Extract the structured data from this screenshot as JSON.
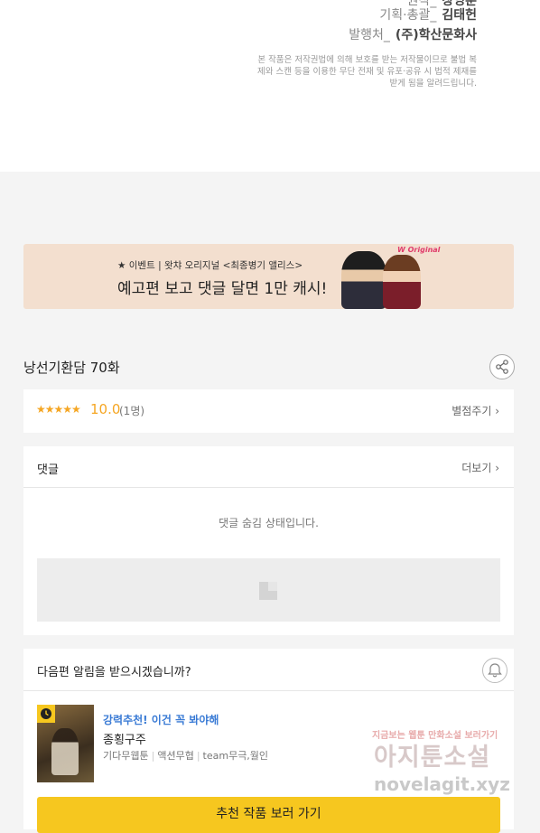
{
  "credits": [
    {
      "label": "원작_",
      "value": "장영훈"
    },
    {
      "label": "기획·총괄_",
      "value": "김태헌"
    },
    {
      "label": "발행처_",
      "value": "(주)학산문화사"
    }
  ],
  "copyright_notice": "본 작품은 저작권법에 의해 보호를 받는 저작물이므로 불법 복제와 스캔 등을 이용한 무단 전재 및 유포·공유 시 법적 제재를 받게 됨을 알려드립니다.",
  "banner": {
    "subtitle": "★ 이벤트 | 왓챠 오리지널 <최종병기 앨리스>",
    "title": "예고편 보고 댓글 달면 1만 캐시!",
    "brand": "W Original"
  },
  "episode": {
    "title": "낭선기환담 70화"
  },
  "rating": {
    "stars": "★★★★★",
    "score": "10.0",
    "count": "(1명)",
    "action": "별점주기 ›"
  },
  "comments": {
    "title": "댓글",
    "more": "더보기 ›",
    "hidden_message": "댓글 숨김 상태입니다."
  },
  "alert": {
    "question": "다음편 알림을 받으시겠습니까?",
    "promo": "강력추천! 이건 꼭 봐야해",
    "work_title": "종횡구주",
    "tags": [
      "기다무웹툰",
      "액션무협",
      "team무극,월인"
    ],
    "button": "추천 작품 보러 가기"
  },
  "watermark": {
    "tagline": "지금보는 웹툰 만화소설 보러가기",
    "name": "아지툰소설",
    "url": "novelagit.xyz"
  },
  "colors": {
    "accent": "#f5a623",
    "button": "#f6c71f",
    "promo_link": "#3a7bd5",
    "page_bg": "#f4f4f4"
  }
}
